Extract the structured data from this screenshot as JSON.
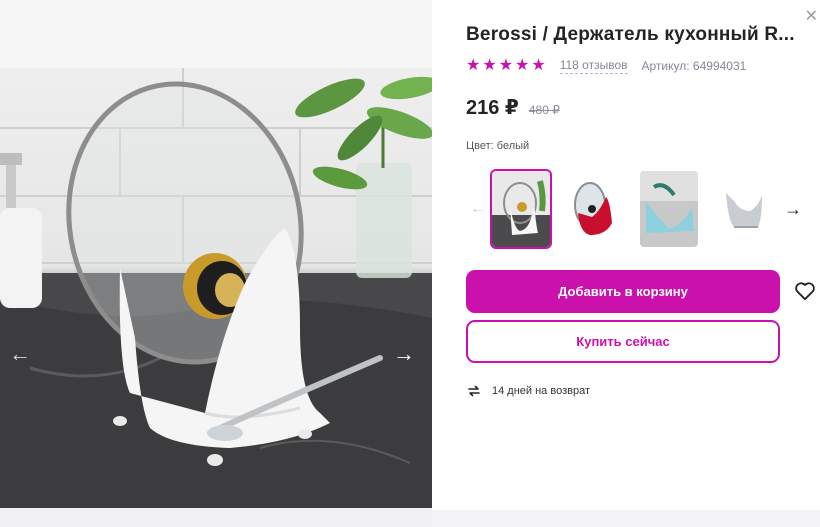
{
  "product": {
    "title": "Berossi / Держатель кухонный R...",
    "rating_stars": 5,
    "reviews": "118 отзывов",
    "sku": "Артикул: 64994031"
  },
  "price": {
    "current": "216 ₽",
    "old": "480 ₽"
  },
  "color": {
    "label": "Цвет:",
    "value": "белый"
  },
  "buttons": {
    "add_to_cart": "Добавить в корзину",
    "buy_now": "Купить сейчас"
  },
  "returns": {
    "text": "14 дней на возврат"
  },
  "icons": {
    "star": "star-icon",
    "heart": "heart-icon",
    "return": "return-arrows-icon",
    "arrow_left": "arrow-left-icon",
    "arrow_right": "arrow-right-icon",
    "close": "close-icon"
  },
  "colors": {
    "accent": "#cb11ab",
    "text": "#242424",
    "muted": "#868695"
  }
}
